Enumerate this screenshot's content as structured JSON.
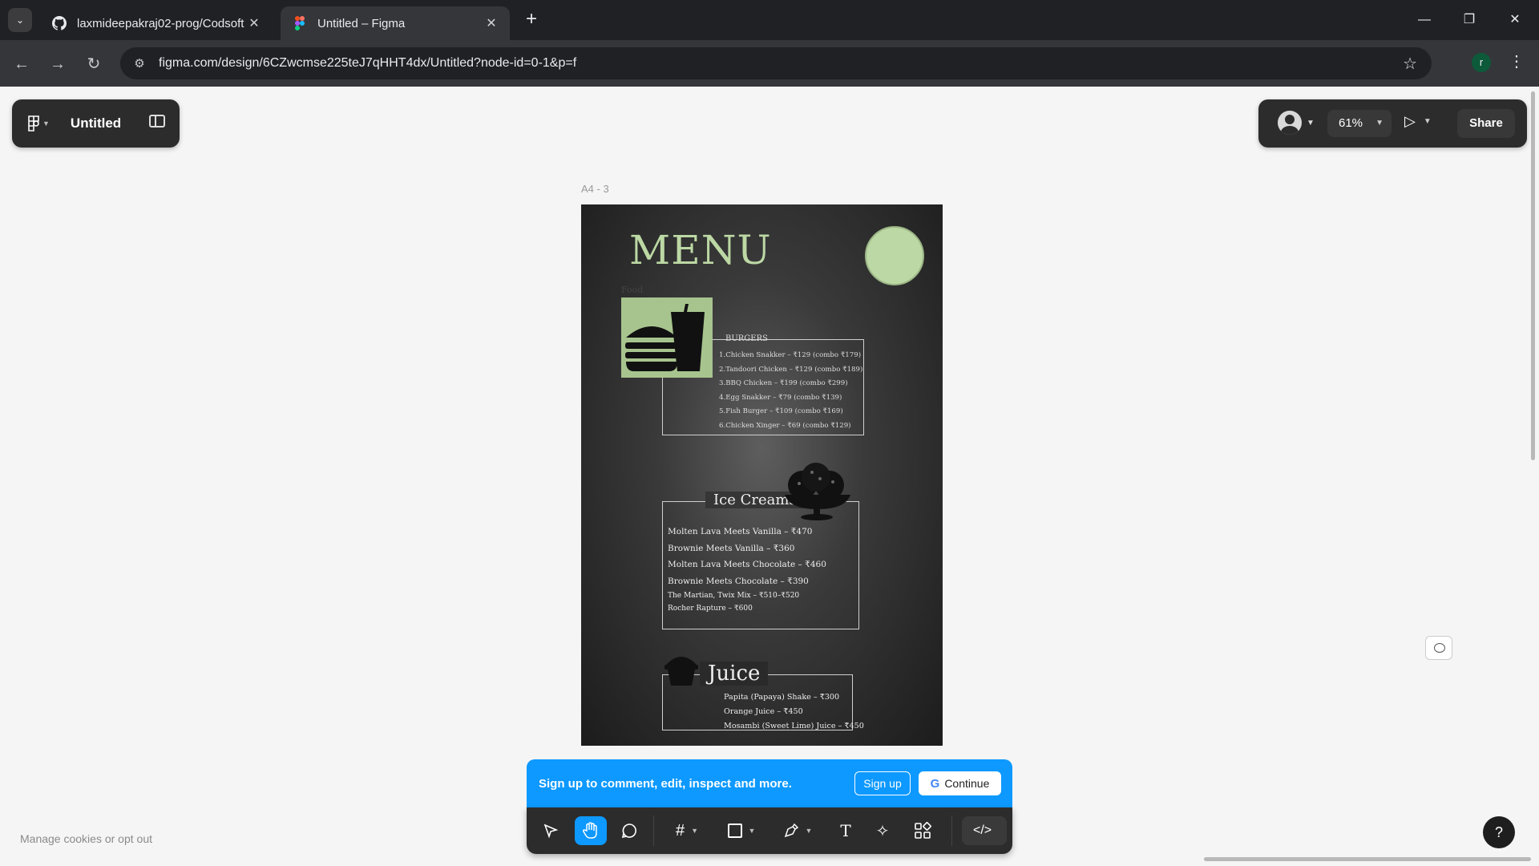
{
  "browser": {
    "tabs": [
      {
        "title": "laxmideepakraj02-prog/Codsoft",
        "favicon": "github-icon",
        "active": false
      },
      {
        "title": "Untitled – Figma",
        "favicon": "figma-icon",
        "active": true
      }
    ],
    "url": "figma.com/design/6CZwcmse225teJ7qHHT4dx/Untitled?node-id=0-1&p=f",
    "profile_initial": "r"
  },
  "figma": {
    "file_name": "Untitled",
    "zoom": "61%",
    "share_label": "Share",
    "frame_label": "A4 - 3",
    "cookies_link": "Manage cookies or opt out",
    "help_label": "?"
  },
  "menu": {
    "title": "MENU",
    "food_label": "Food",
    "burgers": {
      "heading": "BURGERS",
      "items": [
        "1.Chicken Snakker – ₹129 (combo ₹179)",
        "2.Tandoori Chicken – ₹129 (combo ₹189)",
        "3.BBQ Chicken – ₹199 (combo ₹299)",
        "4.Egg Snakker – ₹79 (combo ₹139)",
        "5.Fish Burger – ₹109 (combo ₹169)",
        "6.Chicken Xinger – ₹69 (combo ₹129)"
      ]
    },
    "ice_creams": {
      "heading": "Ice Creams",
      "items": [
        "Molten Lava Meets Vanilla – ₹470",
        "Brownie Meets Vanilla – ₹360",
        "Molten Lava Meets Chocolate – ₹460",
        "Brownie Meets Chocolate – ₹390"
      ],
      "small_items": [
        "The Martian, Twix Mix – ₹510–₹520",
        "Rocher Rapture – ₹600"
      ]
    },
    "juice": {
      "heading": "Juice",
      "items": [
        "Papita (Papaya) Shake – ₹300",
        "Orange Juice – ₹450",
        "Mosambi (Sweet Lime) Juice – ₹450"
      ]
    }
  },
  "signup_banner": {
    "message": "Sign up to comment, edit, inspect and more.",
    "signup_label": "Sign up",
    "continue_label": "Continue"
  },
  "toolbar": {
    "tools": [
      "move-tool",
      "hand-tool",
      "comment-tool",
      "frame-tool",
      "shape-tool",
      "pen-tool",
      "text-tool",
      "actions-tool",
      "assets-tool",
      "dev-mode-toggle"
    ],
    "active_tool": "hand-tool"
  },
  "colors": {
    "accent": "#0d99ff",
    "menu_green": "#bcd8a4",
    "chrome_dark": "#202124"
  }
}
